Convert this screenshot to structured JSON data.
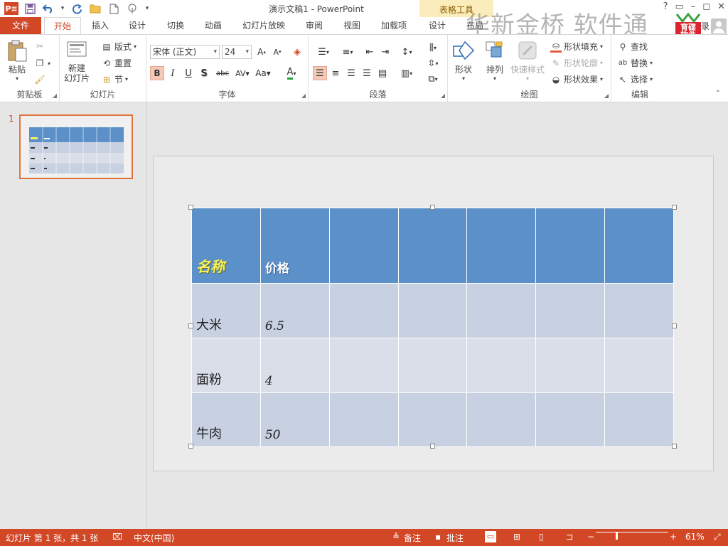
{
  "app": {
    "title": "演示文稿1 - PowerPoint",
    "context_tab_group": "表格工具",
    "app_icon": "P≡"
  },
  "qat": [
    "save-icon",
    "undo-icon",
    "redo-icon",
    "open-icon",
    "new-icon",
    "touch-mode-icon",
    "customize-icon"
  ],
  "tabs": [
    {
      "label": "文件"
    },
    {
      "label": "开始"
    },
    {
      "label": "插入"
    },
    {
      "label": "设计"
    },
    {
      "label": "切换"
    },
    {
      "label": "动画"
    },
    {
      "label": "幻灯片放映"
    },
    {
      "label": "审阅"
    },
    {
      "label": "视图"
    },
    {
      "label": "加载项"
    },
    {
      "label": "设计"
    },
    {
      "label": "布局"
    }
  ],
  "watermark": {
    "text": "华新金桥 软件通",
    "logo_top": "育碟",
    "logo_bottom": "软件",
    "partial_right": "录"
  },
  "ribbon": {
    "clipboard": {
      "label": "剪贴板",
      "paste": "粘贴"
    },
    "slides": {
      "label": "幻灯片",
      "new_slide": "新建\n幻灯片",
      "layout": "版式",
      "reset": "重置",
      "section": "节"
    },
    "font": {
      "label": "字体",
      "font_name": "宋体 (正文)",
      "font_size": "24"
    },
    "paragraph": {
      "label": "段落"
    },
    "drawing": {
      "label": "绘图",
      "shapes": "形状",
      "arrange": "排列",
      "quick_styles": "快速样式",
      "shape_fill": "形状填充",
      "shape_outline": "形状轮廓",
      "shape_effects": "形状效果"
    },
    "editing": {
      "label": "编辑",
      "find": "查找",
      "replace": "替换",
      "select": "选择"
    }
  },
  "thumbnails": [
    {
      "number": "1"
    }
  ],
  "slide_table": {
    "header": [
      "名称",
      "价格",
      "",
      "",
      "",
      "",
      ""
    ],
    "rows": [
      [
        "大米",
        "6.5",
        "",
        "",
        "",
        "",
        ""
      ],
      [
        "面粉",
        "4",
        "",
        "",
        "",
        "",
        ""
      ],
      [
        "牛肉",
        "50",
        "",
        "",
        "",
        "",
        ""
      ]
    ]
  },
  "statusbar": {
    "slide_info": "幻灯片 第 1 张，共 1 张",
    "language": "中文(中国)",
    "notes": "备注",
    "comments": "批注",
    "zoom": "61%"
  },
  "colors": {
    "accent": "#d24726",
    "table_header": "#5b90c8",
    "table_band_dark": "#c7d1e1",
    "table_band_light": "#d9dee9",
    "title_yellow": "#f6f25a"
  }
}
